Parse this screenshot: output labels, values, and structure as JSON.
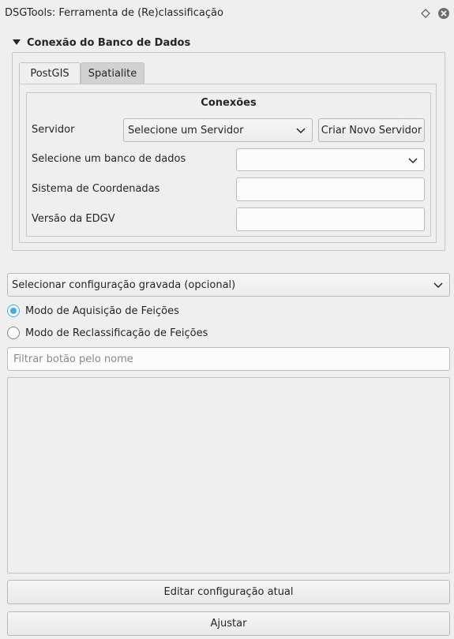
{
  "window": {
    "title": "DSGTools: Ferramenta de (Re)classificação",
    "float_icon": "diamond-icon",
    "close_icon": "close-icon"
  },
  "db_connection": {
    "title": "Conexão do Banco de Dados",
    "collapse_icon": "triangle-down-icon",
    "tabs": [
      {
        "label": "PostGIS",
        "active": true
      },
      {
        "label": "Spatialite",
        "active": false
      }
    ],
    "connections": {
      "title": "Conexões",
      "server_label": "Servidor",
      "server_value": "Selecione um Servidor",
      "new_server_button": "Criar Novo Servidor",
      "database_label": "Selecione um banco de dados",
      "database_value": "",
      "crs_label": "Sistema de Coordenadas",
      "crs_value": "",
      "edgv_label": "Versão da EDGV",
      "edgv_value": ""
    }
  },
  "config_combo": "Selecionar configuração gravada (opcional)",
  "modes": [
    {
      "label": "Modo de Aquisição de Feições",
      "checked": true
    },
    {
      "label": "Modo de Reclassificação de Feições",
      "checked": false
    }
  ],
  "filter": {
    "placeholder": "Filtrar botão pelo nome",
    "value": ""
  },
  "buttons": {
    "edit": "Editar configuração atual",
    "adjust": "Ajustar"
  },
  "colors": {
    "accent": "#3daee9",
    "background": "#efefef"
  }
}
